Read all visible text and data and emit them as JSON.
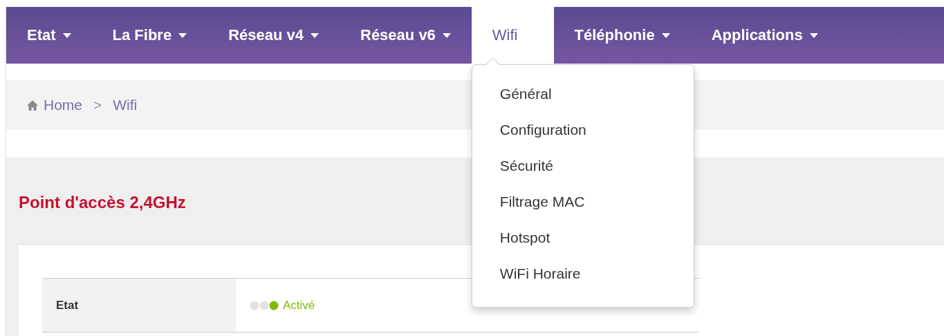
{
  "nav": {
    "items": [
      {
        "label": "Etat",
        "dropdown": true,
        "selected": false
      },
      {
        "label": "La Fibre",
        "dropdown": true,
        "selected": false
      },
      {
        "label": "Réseau v4",
        "dropdown": true,
        "selected": false
      },
      {
        "label": "Réseau v6",
        "dropdown": true,
        "selected": false
      },
      {
        "label": "Wifi",
        "dropdown": false,
        "selected": true
      },
      {
        "label": "Téléphonie",
        "dropdown": true,
        "selected": false
      },
      {
        "label": "Applications",
        "dropdown": true,
        "selected": false
      }
    ]
  },
  "dropdown_menu": {
    "items": [
      "Général",
      "Configuration",
      "Sécurité",
      "Filtrage MAC",
      "Hotspot",
      "WiFi Horaire"
    ]
  },
  "breadcrumb": {
    "items": [
      {
        "label": "Home",
        "kind": "home"
      },
      {
        "label": "Wifi",
        "kind": "current"
      }
    ],
    "separator": ">"
  },
  "section": {
    "title": "Point d'accès 2,4GHz",
    "rows": [
      {
        "label": "Etat",
        "value": "Activé",
        "on": true
      }
    ]
  }
}
